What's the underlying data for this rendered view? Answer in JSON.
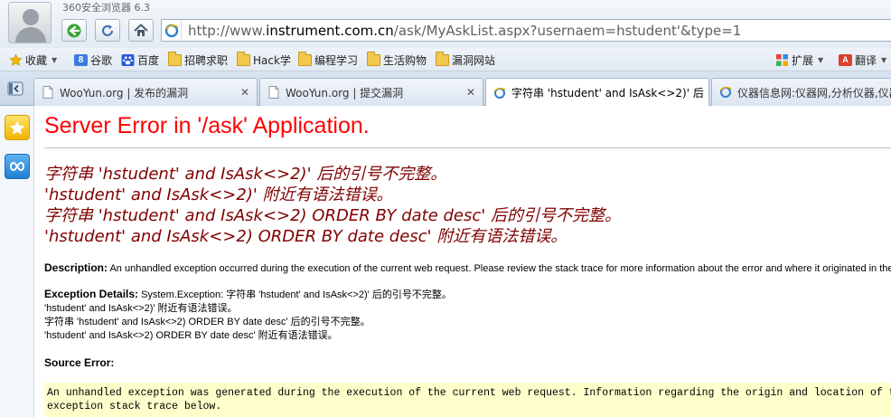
{
  "browser": {
    "app_title": "360安全浏览器 6.3",
    "address": {
      "prefix": "http://www.",
      "domain": "instrument.com.cn",
      "path": "/ask/MyAskList.aspx?usernaem=hstudent'&type=1"
    },
    "nav": {
      "back_icon": "back-arrow-icon",
      "refresh_icon": "refresh-icon",
      "home_icon": "home-icon"
    }
  },
  "bookmarks": {
    "favorites_label": "收藏",
    "items": [
      {
        "label": "谷歌",
        "icon": "google-icon"
      },
      {
        "label": "百度",
        "icon": "baidu-icon"
      },
      {
        "label": "招聘求职",
        "icon": "folder-icon"
      },
      {
        "label": "Hack学",
        "icon": "folder-icon"
      },
      {
        "label": "编程学习",
        "icon": "folder-icon"
      },
      {
        "label": "生活购物",
        "icon": "folder-icon"
      },
      {
        "label": "漏洞网站",
        "icon": "folder-icon"
      }
    ],
    "extensions_label": "扩展",
    "translate_label": "翻译"
  },
  "tabs": [
    {
      "label": "WooYun.org | 发布的漏洞",
      "active": false
    },
    {
      "label": "WooYun.org | 提交漏洞",
      "active": false
    },
    {
      "label": "字符串 'hstudent' and IsAsk<>2)' 后",
      "active": true
    },
    {
      "label": "仪器信息网:仪器网,分析仪器,仪器",
      "active": false
    }
  ],
  "page": {
    "title": "Server Error in '/ask' Application.",
    "error_lines": [
      "字符串 'hstudent' and IsAsk<>2)' 后的引号不完整。",
      "'hstudent' and IsAsk<>2)' 附近有语法错误。",
      "字符串 'hstudent' and IsAsk<>2) ORDER BY date desc' 后的引号不完整。",
      "'hstudent' and IsAsk<>2) ORDER BY date desc' 附近有语法错误。"
    ],
    "description_label": "Description:",
    "description_text": " An unhandled exception occurred during the execution of the current web request. Please review the stack trace for more information about the error and where it originated in the code.",
    "exception_label": "Exception Details:",
    "exception_lines": [
      " System.Exception: 字符串 'hstudent' and IsAsk<>2)' 后的引号不完整。",
      "'hstudent' and IsAsk<>2)' 附近有语法错误。",
      "字符串 'hstudent' and IsAsk<>2) ORDER BY date desc' 后的引号不完整。",
      "'hstudent' and IsAsk<>2) ORDER BY date desc' 附近有语法错误。"
    ],
    "source_error_label": "Source Error:",
    "source_lines": [
      "An unhandled exception was generated during the execution of the current web request. Information regarding the origin and location of the",
      "exception stack trace below."
    ]
  }
}
